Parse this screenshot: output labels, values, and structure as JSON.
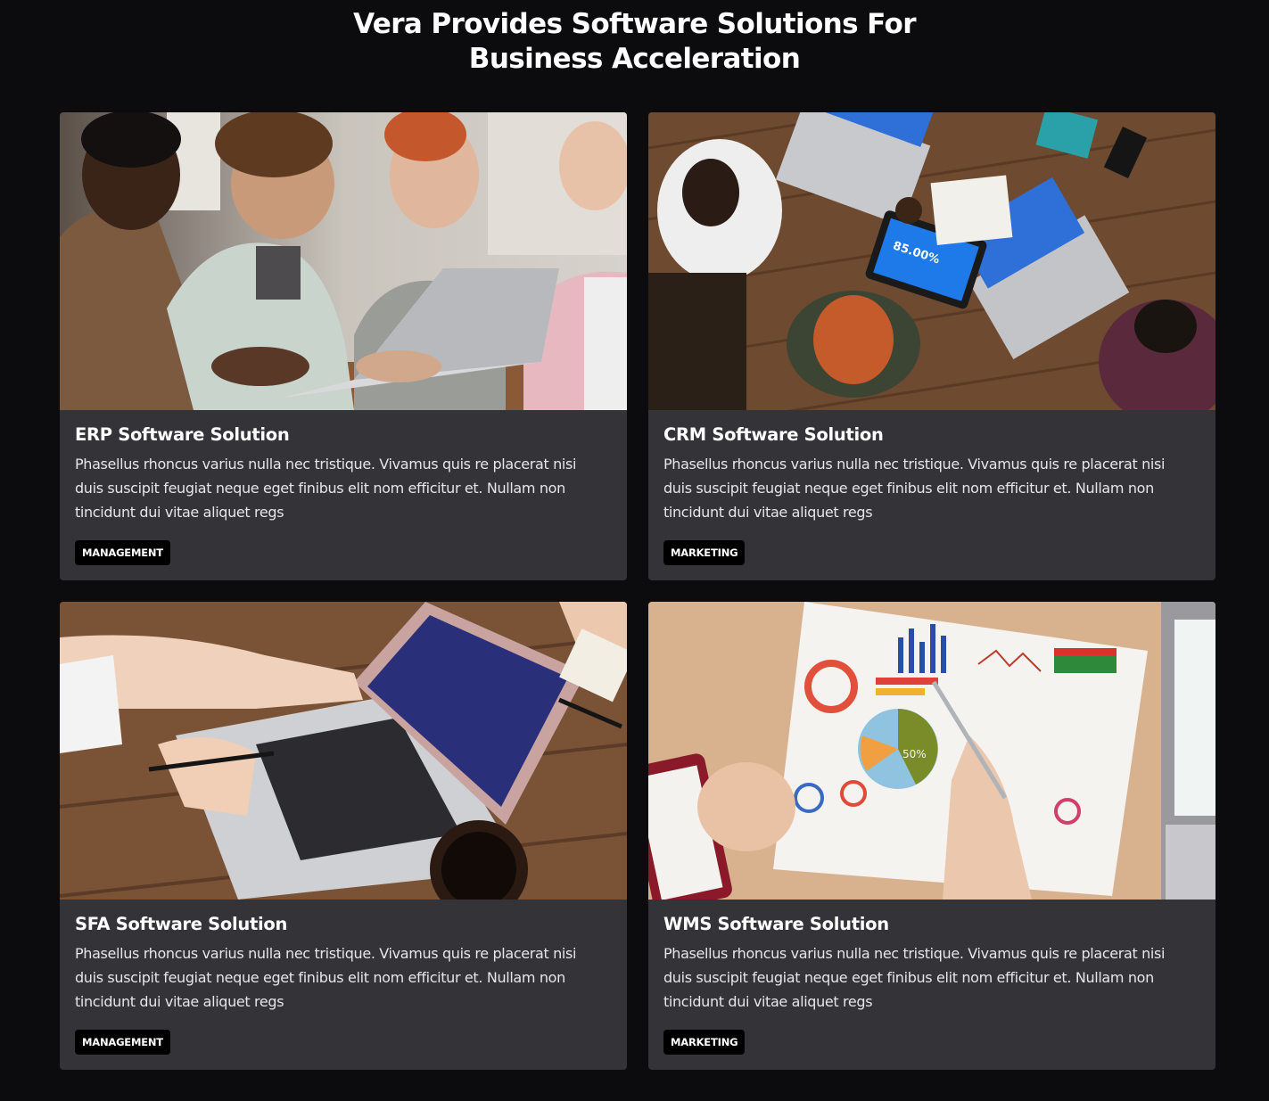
{
  "header": {
    "title_line1": "Vera Provides Software Solutions For",
    "title_line2": "Business Acceleration"
  },
  "colors": {
    "background": "#0c0c0f",
    "card": "#343338",
    "tag": "#000000"
  },
  "cards": [
    {
      "title": "ERP Software Solution",
      "description": "Phasellus rhoncus varius nulla nec tristique. Vivamus quis re placerat nisi duis suscipit feugiat neque eget finibus elit nom efficitur et. Nullam non tincidunt dui vitae aliquet regs",
      "tag": "MANAGEMENT",
      "image": "team-laptop-photo"
    },
    {
      "title": "CRM Software Solution",
      "description": "Phasellus rhoncus varius nulla nec tristique. Vivamus quis re placerat nisi duis suscipit feugiat neque eget finibus elit nom efficitur et. Nullam non tincidunt dui vitae aliquet regs",
      "tag": "MARKETING",
      "image": "overhead-meeting-photo",
      "image_text": "85.00%"
    },
    {
      "title": "SFA Software Solution",
      "description": "Phasellus rhoncus varius nulla nec tristique. Vivamus quis re placerat nisi duis suscipit feugiat neque eget finibus elit nom efficitur et. Nullam non tincidunt dui vitae aliquet regs",
      "tag": "MANAGEMENT",
      "image": "laptop-hands-photo"
    },
    {
      "title": "WMS Software Solution",
      "description": "Phasellus rhoncus varius nulla nec tristique. Vivamus quis re placerat nisi duis suscipit feugiat neque eget finibus elit nom efficitur et. Nullam non tincidunt dui vitae aliquet regs",
      "tag": "MARKETING",
      "image": "charts-report-photo",
      "image_text": "50%"
    }
  ]
}
